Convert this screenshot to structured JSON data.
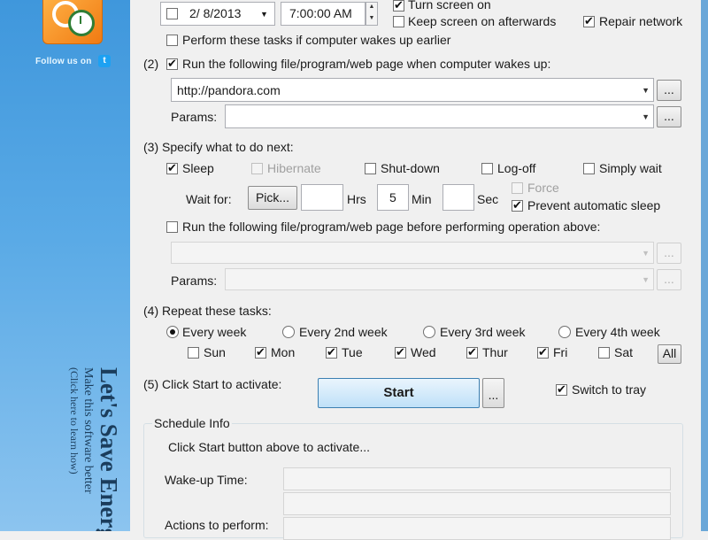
{
  "sidebar": {
    "follow_text": "Follow us on",
    "twitter_icon": "t",
    "slogan_line1": "Let's Save Energy!",
    "slogan_line2": "Make this software better",
    "slogan_line3": "(Click here to learn how)"
  },
  "section1": {
    "date_value": "2/ 8/2013",
    "time_value": "7:00:00 AM",
    "turn_screen_on": {
      "label": "Turn screen on",
      "checked": true
    },
    "keep_screen_on": {
      "label": "Keep screen on afterwards",
      "checked": false
    },
    "repair_network": {
      "label": "Repair network",
      "checked": true
    },
    "wakes_earlier": {
      "label": "Perform these tasks if computer wakes up earlier",
      "checked": false
    }
  },
  "section2": {
    "label": "Run the following file/program/web page when computer wakes up:",
    "num": "(2)",
    "checked": true,
    "file_value": "http://pandora.com",
    "params_label": "Params:",
    "browse_label": "..."
  },
  "section3": {
    "label": "(3) Specify what to do next:",
    "options": [
      "Sleep",
      "Hibernate",
      "Shut-down",
      "Log-off",
      "Simply wait"
    ],
    "sleep_checked": true,
    "wait_for_label": "Wait for:",
    "pick_label": "Pick...",
    "hrs_label": "Hrs",
    "min_value": "5",
    "min_label": "Min",
    "sec_label": "Sec",
    "force_label": "Force",
    "prevent_label": "Prevent automatic sleep",
    "prevent_checked": true,
    "run_before_label": "Run the following file/program/web page before performing operation above:",
    "params_label": "Params:",
    "browse_label": "..."
  },
  "section4": {
    "label": "(4) Repeat these tasks:",
    "frequencies": [
      "Every week",
      "Every 2nd week",
      "Every 3rd week",
      "Every 4th week"
    ],
    "selected_frequency": "Every week",
    "days": [
      "Sun",
      "Mon",
      "Tue",
      "Wed",
      "Thur",
      "Fri",
      "Sat"
    ],
    "days_checked": [
      false,
      true,
      true,
      true,
      true,
      true,
      false
    ],
    "all_label": "All"
  },
  "section5": {
    "label": "(5) Click Start to activate:",
    "start_label": "Start",
    "more_label": "...",
    "switch_tray_label": "Switch to tray",
    "switch_tray_checked": true
  },
  "schedule_info": {
    "title": "Schedule Info",
    "hint": "Click Start button above to activate...",
    "wake_time_label": "Wake-up Time:",
    "actions_label": "Actions to perform:"
  },
  "colors": {
    "sidebar_top": "#3f97dc",
    "start_button": "#bfe0f8",
    "logo_orange": "#f07a12"
  }
}
